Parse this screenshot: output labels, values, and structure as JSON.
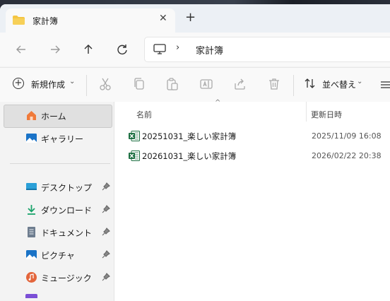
{
  "tab": {
    "title": "家計簿",
    "close": "✕",
    "new_tab": "+"
  },
  "address": {
    "chevron": "›",
    "location": "家計簿"
  },
  "toolbar": {
    "new_label": "新規作成",
    "new_caret": "⌄",
    "sort_label": "並べ替え",
    "sort_caret": "⌄"
  },
  "sidebar": {
    "top_items": [
      {
        "label": "ホーム",
        "icon": "home-icon"
      },
      {
        "label": "ギャラリー",
        "icon": "gallery-icon"
      }
    ],
    "pinned_items": [
      {
        "label": "デスクトップ",
        "icon": "desktop-icon"
      },
      {
        "label": "ダウンロード",
        "icon": "download-icon"
      },
      {
        "label": "ドキュメント",
        "icon": "documents-icon"
      },
      {
        "label": "ピクチャ",
        "icon": "pictures-icon"
      },
      {
        "label": "ミュージック",
        "icon": "music-icon"
      }
    ]
  },
  "files": {
    "columns": {
      "name": "名前",
      "modified": "更新日時"
    },
    "sort_indicator": "^",
    "rows": [
      {
        "name": "20251031_楽しい家計簿",
        "modified": "2025/11/09 16:08",
        "icon": "excel-icon"
      },
      {
        "name": "20261031_楽しい家計簿",
        "modified": "2026/02/22 20:38",
        "icon": "excel-icon"
      }
    ]
  },
  "colors": {
    "accent": "#0067c0",
    "folder": "#f4c542",
    "excel": "#1d6f42",
    "selection": "#e0e0e0"
  }
}
